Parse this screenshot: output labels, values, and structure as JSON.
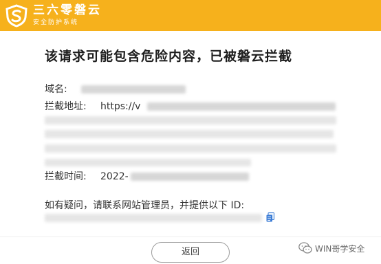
{
  "header": {
    "brand_name": "三六零磐云",
    "brand_subtitle": "安全防护系统",
    "logo_icon": "shield-s-logo",
    "background_color": "#f6b11c"
  },
  "main": {
    "headline": "该请求可能包含危险内容，已被磐云拦截",
    "domain_label": "域名:",
    "url_label": "拦截地址:",
    "url_prefix": "https://v",
    "time_label": "拦截时间:",
    "time_prefix": "2022-",
    "contact_text": "如有疑问，请联系网站管理员，并提供以下 ID:",
    "copy_icon": "copy-icon"
  },
  "footer": {
    "back_label": "返回"
  },
  "watermark": {
    "text": "WIN哥学安全",
    "icon": "wechat-icon"
  }
}
